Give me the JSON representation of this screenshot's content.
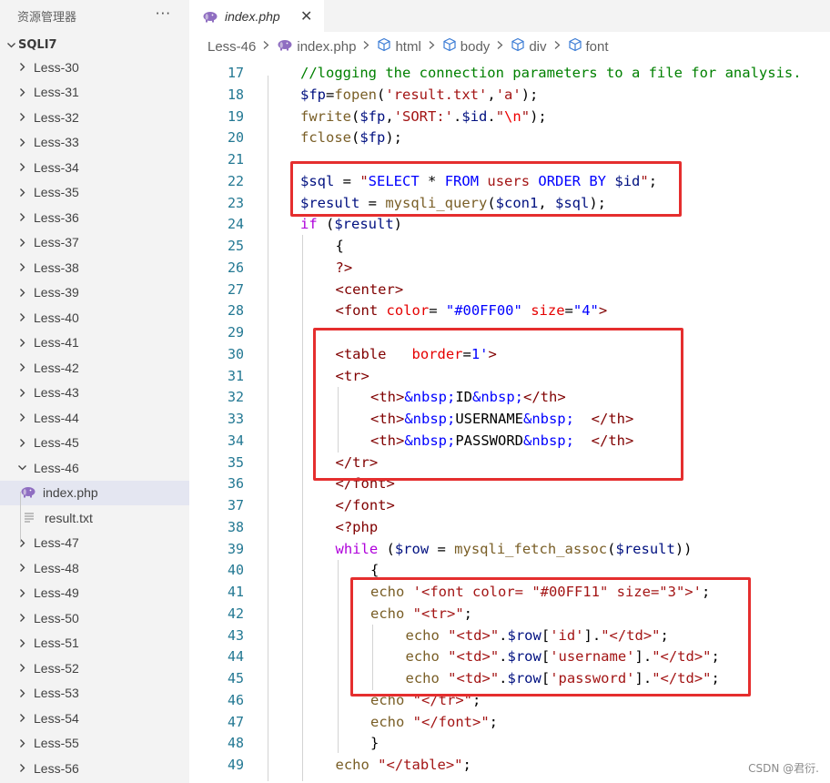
{
  "sidebar": {
    "title": "资源管理器",
    "more_label": "···",
    "root_label": "SQLI7",
    "items": [
      {
        "label": "Less-30",
        "kind": "folder"
      },
      {
        "label": "Less-31",
        "kind": "folder"
      },
      {
        "label": "Less-32",
        "kind": "folder"
      },
      {
        "label": "Less-33",
        "kind": "folder"
      },
      {
        "label": "Less-34",
        "kind": "folder"
      },
      {
        "label": "Less-35",
        "kind": "folder"
      },
      {
        "label": "Less-36",
        "kind": "folder"
      },
      {
        "label": "Less-37",
        "kind": "folder"
      },
      {
        "label": "Less-38",
        "kind": "folder"
      },
      {
        "label": "Less-39",
        "kind": "folder"
      },
      {
        "label": "Less-40",
        "kind": "folder"
      },
      {
        "label": "Less-41",
        "kind": "folder"
      },
      {
        "label": "Less-42",
        "kind": "folder"
      },
      {
        "label": "Less-43",
        "kind": "folder"
      },
      {
        "label": "Less-44",
        "kind": "folder"
      },
      {
        "label": "Less-45",
        "kind": "folder"
      },
      {
        "label": "Less-46",
        "kind": "folder-open"
      },
      {
        "label": "index.php",
        "kind": "php"
      },
      {
        "label": "result.txt",
        "kind": "txt"
      },
      {
        "label": "Less-47",
        "kind": "folder"
      },
      {
        "label": "Less-48",
        "kind": "folder"
      },
      {
        "label": "Less-49",
        "kind": "folder"
      },
      {
        "label": "Less-50",
        "kind": "folder"
      },
      {
        "label": "Less-51",
        "kind": "folder"
      },
      {
        "label": "Less-52",
        "kind": "folder"
      },
      {
        "label": "Less-53",
        "kind": "folder"
      },
      {
        "label": "Less-54",
        "kind": "folder"
      },
      {
        "label": "Less-55",
        "kind": "folder"
      },
      {
        "label": "Less-56",
        "kind": "folder"
      }
    ]
  },
  "tab": {
    "label": "index.php",
    "close": "✕"
  },
  "breadcrumb": [
    "Less-46",
    "index.php",
    "html",
    "body",
    "div",
    "font"
  ],
  "editor": {
    "line_numbers": [
      "17",
      "18",
      "19",
      "20",
      "21",
      "22",
      "23",
      "24",
      "25",
      "26",
      "27",
      "28",
      "29",
      "30",
      "31",
      "32",
      "33",
      "34",
      "35",
      "36",
      "37",
      "38",
      "39",
      "40",
      "41",
      "42",
      "43",
      "44",
      "45",
      "46",
      "47",
      "48",
      "49"
    ],
    "lines": [
      {
        "indent": 0,
        "tokens": [
          [
            "c-comment",
            "//logging the connection parameters to a file for analysis."
          ]
        ]
      },
      {
        "indent": 0,
        "tokens": [
          [
            "c-var",
            "$fp"
          ],
          [
            "c-plain",
            "="
          ],
          [
            "c-func",
            "fopen"
          ],
          [
            "c-plain",
            "("
          ],
          [
            "c-str",
            "'result.txt'"
          ],
          [
            "c-plain",
            ","
          ],
          [
            "c-str",
            "'a'"
          ],
          [
            "c-plain",
            ");"
          ]
        ]
      },
      {
        "indent": 0,
        "tokens": [
          [
            "c-func",
            "fwrite"
          ],
          [
            "c-plain",
            "("
          ],
          [
            "c-var",
            "$fp"
          ],
          [
            "c-plain",
            ","
          ],
          [
            "c-str",
            "'SORT:'"
          ],
          [
            "c-plain",
            "."
          ],
          [
            "c-var",
            "$id"
          ],
          [
            "c-plain",
            "."
          ],
          [
            "c-str",
            "\""
          ],
          [
            "c-esc",
            "\\n"
          ],
          [
            "c-str",
            "\""
          ],
          [
            "c-plain",
            ");"
          ]
        ]
      },
      {
        "indent": 0,
        "tokens": [
          [
            "c-func",
            "fclose"
          ],
          [
            "c-plain",
            "("
          ],
          [
            "c-var",
            "$fp"
          ],
          [
            "c-plain",
            ");"
          ]
        ]
      },
      {
        "indent": 0,
        "tokens": []
      },
      {
        "indent": 0,
        "tokens": [
          [
            "c-var",
            "$sql"
          ],
          [
            "c-plain",
            " = "
          ],
          [
            "c-str",
            "\""
          ],
          [
            "c-sql",
            "SELECT"
          ],
          [
            "c-str",
            " "
          ],
          [
            "c-plain",
            "*"
          ],
          [
            "c-str",
            " "
          ],
          [
            "c-sql",
            "FROM"
          ],
          [
            "c-str",
            " users "
          ],
          [
            "c-sql",
            "ORDER BY"
          ],
          [
            "c-str",
            " "
          ],
          [
            "c-var",
            "$id"
          ],
          [
            "c-str",
            "\""
          ],
          [
            "c-plain",
            ";"
          ]
        ]
      },
      {
        "indent": 0,
        "tokens": [
          [
            "c-var",
            "$result"
          ],
          [
            "c-plain",
            " = "
          ],
          [
            "c-func",
            "mysqli_query"
          ],
          [
            "c-plain",
            "("
          ],
          [
            "c-var",
            "$con1"
          ],
          [
            "c-plain",
            ", "
          ],
          [
            "c-var",
            "$sql"
          ],
          [
            "c-plain",
            ");"
          ]
        ]
      },
      {
        "indent": 0,
        "tokens": [
          [
            "c-ctrl",
            "if"
          ],
          [
            "c-plain",
            " ("
          ],
          [
            "c-var",
            "$result"
          ],
          [
            "c-plain",
            ")"
          ]
        ]
      },
      {
        "indent": 1,
        "tokens": [
          [
            "c-plain",
            "{"
          ]
        ]
      },
      {
        "indent": 1,
        "tokens": [
          [
            "c-php",
            "?>"
          ]
        ]
      },
      {
        "indent": 1,
        "tokens": [
          [
            "c-tag",
            "<center>"
          ]
        ]
      },
      {
        "indent": 1,
        "tokens": [
          [
            "c-tag",
            "<font"
          ],
          [
            "c-plain",
            " "
          ],
          [
            "c-attr",
            "color"
          ],
          [
            "c-plain",
            "= "
          ],
          [
            "c-attrval",
            "\"#00FF00\""
          ],
          [
            "c-plain",
            " "
          ],
          [
            "c-attr",
            "size"
          ],
          [
            "c-plain",
            "="
          ],
          [
            "c-attrval",
            "\"4\""
          ],
          [
            "c-tag",
            ">"
          ]
        ]
      },
      {
        "indent": 1,
        "tokens": []
      },
      {
        "indent": 1,
        "tokens": [
          [
            "c-tag",
            "<table"
          ],
          [
            "c-plain",
            "   "
          ],
          [
            "c-attr",
            "border"
          ],
          [
            "c-plain",
            "="
          ],
          [
            "c-attrval",
            "1'"
          ],
          [
            "c-tag",
            ">"
          ]
        ]
      },
      {
        "indent": 1,
        "tokens": [
          [
            "c-tag",
            "<tr>"
          ]
        ]
      },
      {
        "indent": 2,
        "tokens": [
          [
            "c-tag",
            "<th>"
          ],
          [
            "c-ent",
            "&nbsp;"
          ],
          [
            "c-plain",
            "ID"
          ],
          [
            "c-ent",
            "&nbsp;"
          ],
          [
            "c-tag",
            "</th>"
          ]
        ]
      },
      {
        "indent": 2,
        "tokens": [
          [
            "c-tag",
            "<th>"
          ],
          [
            "c-ent",
            "&nbsp;"
          ],
          [
            "c-plain",
            "USERNAME"
          ],
          [
            "c-ent",
            "&nbsp;"
          ],
          [
            "c-plain",
            "  "
          ],
          [
            "c-tag",
            "</th>"
          ]
        ]
      },
      {
        "indent": 2,
        "tokens": [
          [
            "c-tag",
            "<th>"
          ],
          [
            "c-ent",
            "&nbsp;"
          ],
          [
            "c-plain",
            "PASSWORD"
          ],
          [
            "c-ent",
            "&nbsp;"
          ],
          [
            "c-plain",
            "  "
          ],
          [
            "c-tag",
            "</th>"
          ]
        ]
      },
      {
        "indent": 1,
        "tokens": [
          [
            "c-tag",
            "</tr>"
          ]
        ]
      },
      {
        "indent": 1,
        "tokens": [
          [
            "c-tag",
            "</font>"
          ]
        ]
      },
      {
        "indent": 1,
        "tokens": [
          [
            "c-tag",
            "</font>"
          ]
        ]
      },
      {
        "indent": 1,
        "tokens": [
          [
            "c-php",
            "<?php"
          ]
        ]
      },
      {
        "indent": 1,
        "tokens": [
          [
            "c-ctrl",
            "while"
          ],
          [
            "c-plain",
            " ("
          ],
          [
            "c-var",
            "$row"
          ],
          [
            "c-plain",
            " = "
          ],
          [
            "c-func",
            "mysqli_fetch_assoc"
          ],
          [
            "c-plain",
            "("
          ],
          [
            "c-var",
            "$result"
          ],
          [
            "c-plain",
            "))"
          ]
        ]
      },
      {
        "indent": 2,
        "tokens": [
          [
            "c-plain",
            "{"
          ]
        ]
      },
      {
        "indent": 2,
        "tokens": [
          [
            "c-echo",
            "echo"
          ],
          [
            "c-plain",
            " "
          ],
          [
            "c-str",
            "'<font color= \"#00FF11\" size=\"3\">'"
          ],
          [
            "c-plain",
            ";"
          ]
        ]
      },
      {
        "indent": 2,
        "tokens": [
          [
            "c-echo",
            "echo"
          ],
          [
            "c-plain",
            " "
          ],
          [
            "c-str",
            "\"<tr>\""
          ],
          [
            "c-plain",
            ";"
          ]
        ]
      },
      {
        "indent": 3,
        "tokens": [
          [
            "c-echo",
            "echo"
          ],
          [
            "c-plain",
            " "
          ],
          [
            "c-str",
            "\"<td>\""
          ],
          [
            "c-plain",
            "."
          ],
          [
            "c-var",
            "$row"
          ],
          [
            "c-plain",
            "["
          ],
          [
            "c-str",
            "'id'"
          ],
          [
            "c-plain",
            "]."
          ],
          [
            "c-str",
            "\"</td>\""
          ],
          [
            "c-plain",
            ";"
          ]
        ]
      },
      {
        "indent": 3,
        "tokens": [
          [
            "c-echo",
            "echo"
          ],
          [
            "c-plain",
            " "
          ],
          [
            "c-str",
            "\"<td>\""
          ],
          [
            "c-plain",
            "."
          ],
          [
            "c-var",
            "$row"
          ],
          [
            "c-plain",
            "["
          ],
          [
            "c-str",
            "'username'"
          ],
          [
            "c-plain",
            "]."
          ],
          [
            "c-str",
            "\"</td>\""
          ],
          [
            "c-plain",
            ";"
          ]
        ]
      },
      {
        "indent": 3,
        "tokens": [
          [
            "c-echo",
            "echo"
          ],
          [
            "c-plain",
            " "
          ],
          [
            "c-str",
            "\"<td>\""
          ],
          [
            "c-plain",
            "."
          ],
          [
            "c-var",
            "$row"
          ],
          [
            "c-plain",
            "["
          ],
          [
            "c-str",
            "'password'"
          ],
          [
            "c-plain",
            "]."
          ],
          [
            "c-str",
            "\"</td>\""
          ],
          [
            "c-plain",
            ";"
          ]
        ]
      },
      {
        "indent": 2,
        "tokens": [
          [
            "c-echo",
            "echo"
          ],
          [
            "c-plain",
            " "
          ],
          [
            "c-str",
            "\"</tr>\""
          ],
          [
            "c-plain",
            ";"
          ]
        ]
      },
      {
        "indent": 2,
        "tokens": [
          [
            "c-echo",
            "echo"
          ],
          [
            "c-plain",
            " "
          ],
          [
            "c-str",
            "\"</font>\""
          ],
          [
            "c-plain",
            ";"
          ]
        ]
      },
      {
        "indent": 2,
        "tokens": [
          [
            "c-plain",
            "}"
          ]
        ]
      },
      {
        "indent": 1,
        "tokens": [
          [
            "c-echo",
            "echo"
          ],
          [
            "c-plain",
            " "
          ],
          [
            "c-str",
            "\"</table>\""
          ],
          [
            "c-plain",
            ";"
          ]
        ]
      }
    ]
  },
  "watermark": "CSDN @君衍.",
  "colors": {
    "highlight_box": "#e52e2e",
    "line_number": "#237893",
    "sidebar_bg": "#f3f3f3",
    "active_item_bg": "#e4e6f1"
  }
}
